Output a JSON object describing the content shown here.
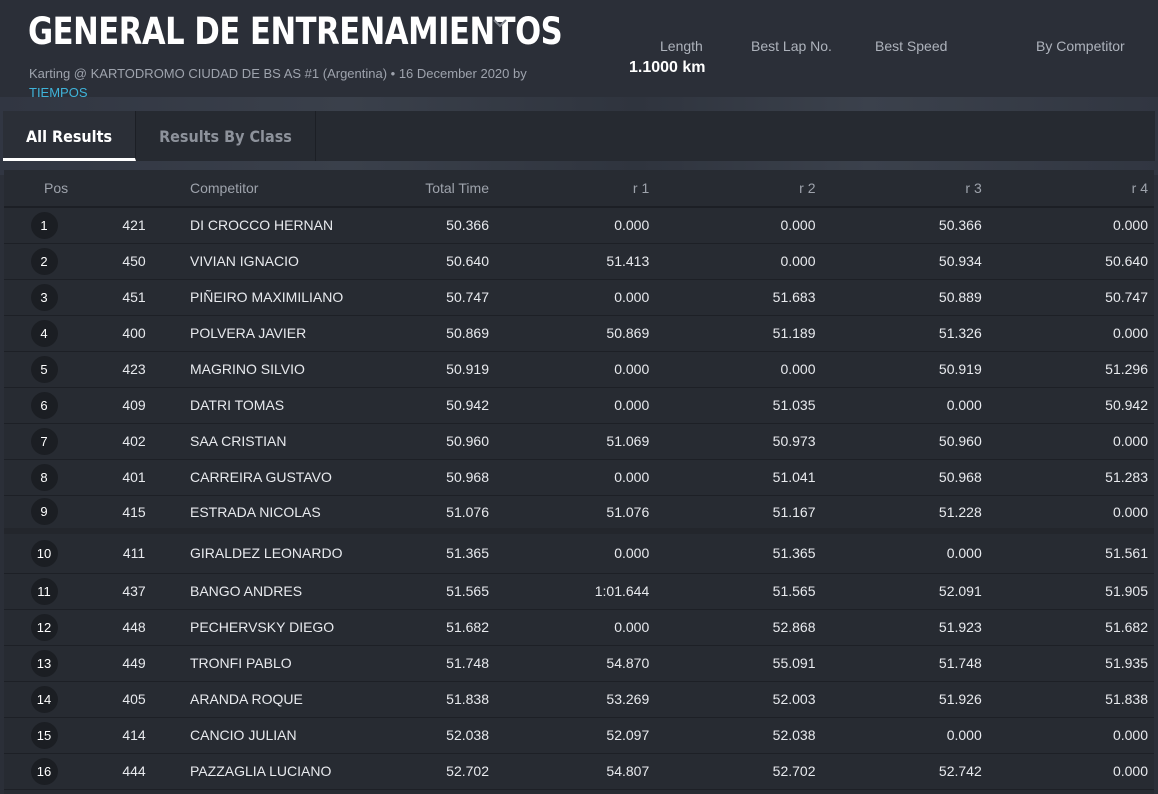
{
  "header": {
    "title": "GENERAL DE ENTRENAMIENTOS",
    "subtitle_prefix": "Karting @ KARTODROMO CIUDAD DE BS AS #1 (Argentina) • 16 December 2020 by",
    "subtitle_link": "TIEMPOS",
    "stats": {
      "length_label": "Length",
      "length_value": "1.1000 km",
      "best_lap_label": "Best Lap No.",
      "best_speed_label": "Best Speed",
      "by_competitor_label": "By Competitor"
    }
  },
  "tabs": [
    {
      "label": "All Results",
      "active": true
    },
    {
      "label": "Results By Class",
      "active": false
    }
  ],
  "table": {
    "columns": {
      "pos": "Pos",
      "number": "",
      "competitor": "Competitor",
      "total_time": "Total Time",
      "r1": "r 1",
      "r2": "r 2",
      "r3": "r 3",
      "r4": "r 4"
    },
    "rows": [
      {
        "pos": "1",
        "number": "421",
        "competitor": "DI CROCCO HERNAN",
        "total_time": "50.366",
        "r1": "0.000",
        "r2": "0.000",
        "r3": "50.366",
        "r4": "0.000"
      },
      {
        "pos": "2",
        "number": "450",
        "competitor": "VIVIAN IGNACIO",
        "total_time": "50.640",
        "r1": "51.413",
        "r2": "0.000",
        "r3": "50.934",
        "r4": "50.640"
      },
      {
        "pos": "3",
        "number": "451",
        "competitor": "PIÑEIRO MAXIMILIANO",
        "total_time": "50.747",
        "r1": "0.000",
        "r2": "51.683",
        "r3": "50.889",
        "r4": "50.747"
      },
      {
        "pos": "4",
        "number": "400",
        "competitor": "POLVERA JAVIER",
        "total_time": "50.869",
        "r1": "50.869",
        "r2": "51.189",
        "r3": "51.326",
        "r4": "0.000"
      },
      {
        "pos": "5",
        "number": "423",
        "competitor": "MAGRINO SILVIO",
        "total_time": "50.919",
        "r1": "0.000",
        "r2": "0.000",
        "r3": "50.919",
        "r4": "51.296"
      },
      {
        "pos": "6",
        "number": "409",
        "competitor": "DATRI TOMAS",
        "total_time": "50.942",
        "r1": "0.000",
        "r2": "51.035",
        "r3": "0.000",
        "r4": "50.942"
      },
      {
        "pos": "7",
        "number": "402",
        "competitor": "SAA CRISTIAN",
        "total_time": "50.960",
        "r1": "51.069",
        "r2": "50.973",
        "r3": "50.960",
        "r4": "0.000"
      },
      {
        "pos": "8",
        "number": "401",
        "competitor": "CARREIRA GUSTAVO",
        "total_time": "50.968",
        "r1": "0.000",
        "r2": "51.041",
        "r3": "50.968",
        "r4": "51.283"
      },
      {
        "pos": "9",
        "number": "415",
        "competitor": "ESTRADA NICOLAS",
        "total_time": "51.076",
        "r1": "51.076",
        "r2": "51.167",
        "r3": "51.228",
        "r4": "0.000"
      },
      {
        "pos": "10",
        "number": "411",
        "competitor": "GIRALDEZ LEONARDO",
        "total_time": "51.365",
        "r1": "0.000",
        "r2": "51.365",
        "r3": "0.000",
        "r4": "51.561"
      },
      {
        "pos": "11",
        "number": "437",
        "competitor": "BANGO ANDRES",
        "total_time": "51.565",
        "r1": "1:01.644",
        "r2": "51.565",
        "r3": "52.091",
        "r4": "51.905"
      },
      {
        "pos": "12",
        "number": "448",
        "competitor": "PECHERVSKY DIEGO",
        "total_time": "51.682",
        "r1": "0.000",
        "r2": "52.868",
        "r3": "51.923",
        "r4": "51.682"
      },
      {
        "pos": "13",
        "number": "449",
        "competitor": "TRONFI PABLO",
        "total_time": "51.748",
        "r1": "54.870",
        "r2": "55.091",
        "r3": "51.748",
        "r4": "51.935"
      },
      {
        "pos": "14",
        "number": "405",
        "competitor": "ARANDA ROQUE",
        "total_time": "51.838",
        "r1": "53.269",
        "r2": "52.003",
        "r3": "51.926",
        "r4": "51.838"
      },
      {
        "pos": "15",
        "number": "414",
        "competitor": "CANCIO JULIAN",
        "total_time": "52.038",
        "r1": "52.097",
        "r2": "52.038",
        "r3": "0.000",
        "r4": "0.000"
      },
      {
        "pos": "16",
        "number": "444",
        "competitor": "PAZZAGLIA LUCIANO",
        "total_time": "52.702",
        "r1": "54.807",
        "r2": "52.702",
        "r3": "52.742",
        "r4": "0.000"
      }
    ]
  }
}
